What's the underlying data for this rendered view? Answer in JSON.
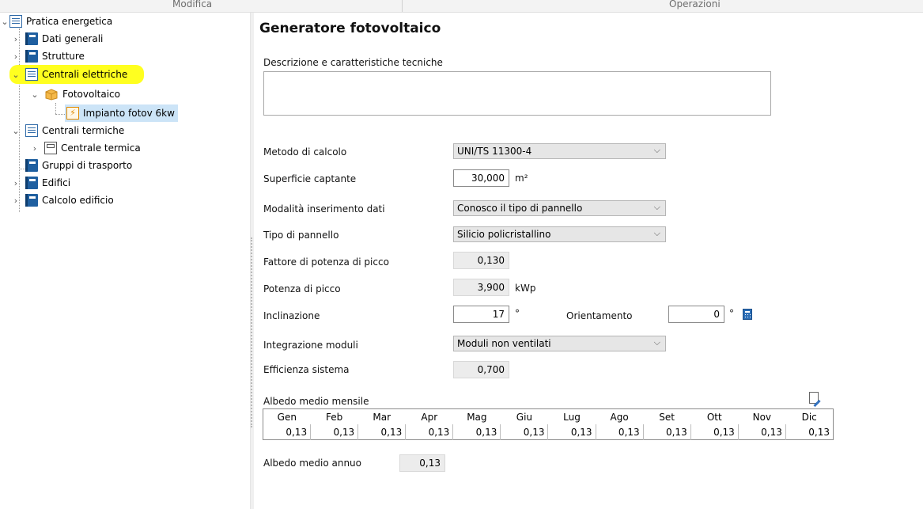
{
  "ribbon": {
    "group_left": "Modifica",
    "group_right": "Operazioni"
  },
  "tree": {
    "root": "Pratica energetica",
    "dati_generali": "Dati generali",
    "strutture": "Strutture",
    "centrali_elettriche": "Centrali elettriche",
    "fotovoltaico": "Fotovoltaico",
    "impianto": "Impianto fotov 6kw",
    "centrali_termiche": "Centrali termiche",
    "centrale_termica": "Centrale termica",
    "gruppi_trasporto": "Gruppi di trasporto",
    "edifici": "Edifici",
    "calcolo_edificio": "Calcolo edificio",
    "highlight_color": "#ffff20"
  },
  "form": {
    "title": "Generatore fotovoltaico",
    "descrizione_label": "Descrizione e caratteristiche tecniche",
    "descrizione_value": "",
    "metodo_label": "Metodo di calcolo",
    "metodo_value": "UNI/TS 11300-4",
    "superficie_label": "Superficie captante",
    "superficie_value": "30,000",
    "superficie_unit": "m²",
    "modalita_label": "Modalità inserimento dati",
    "modalita_value": "Conosco il tipo di pannello",
    "tipo_label": "Tipo di pannello",
    "tipo_value": "Silicio policristallino",
    "fattore_label": "Fattore di potenza di picco",
    "fattore_value": "0,130",
    "potenza_label": "Potenza di picco",
    "potenza_value": "3,900",
    "potenza_unit": "kWp",
    "inclinazione_label": "Inclinazione",
    "inclinazione_value": "17",
    "inclinazione_unit": "°",
    "orientamento_label": "Orientamento",
    "orientamento_value": "0",
    "orientamento_unit": "°",
    "integrazione_label": "Integrazione moduli",
    "integrazione_value": "Moduli non ventilati",
    "efficienza_label": "Efficienza sistema",
    "efficienza_value": "0,700",
    "albedo_label": "Albedo medio mensile",
    "months": [
      "Gen",
      "Feb",
      "Mar",
      "Apr",
      "Mag",
      "Giu",
      "Lug",
      "Ago",
      "Set",
      "Ott",
      "Nov",
      "Dic"
    ],
    "albedo_values": [
      "0,13",
      "0,13",
      "0,13",
      "0,13",
      "0,13",
      "0,13",
      "0,13",
      "0,13",
      "0,13",
      "0,13",
      "0,13",
      "0,13"
    ],
    "albedo_annuo_label": "Albedo medio annuo",
    "albedo_annuo_value": "0,13"
  }
}
